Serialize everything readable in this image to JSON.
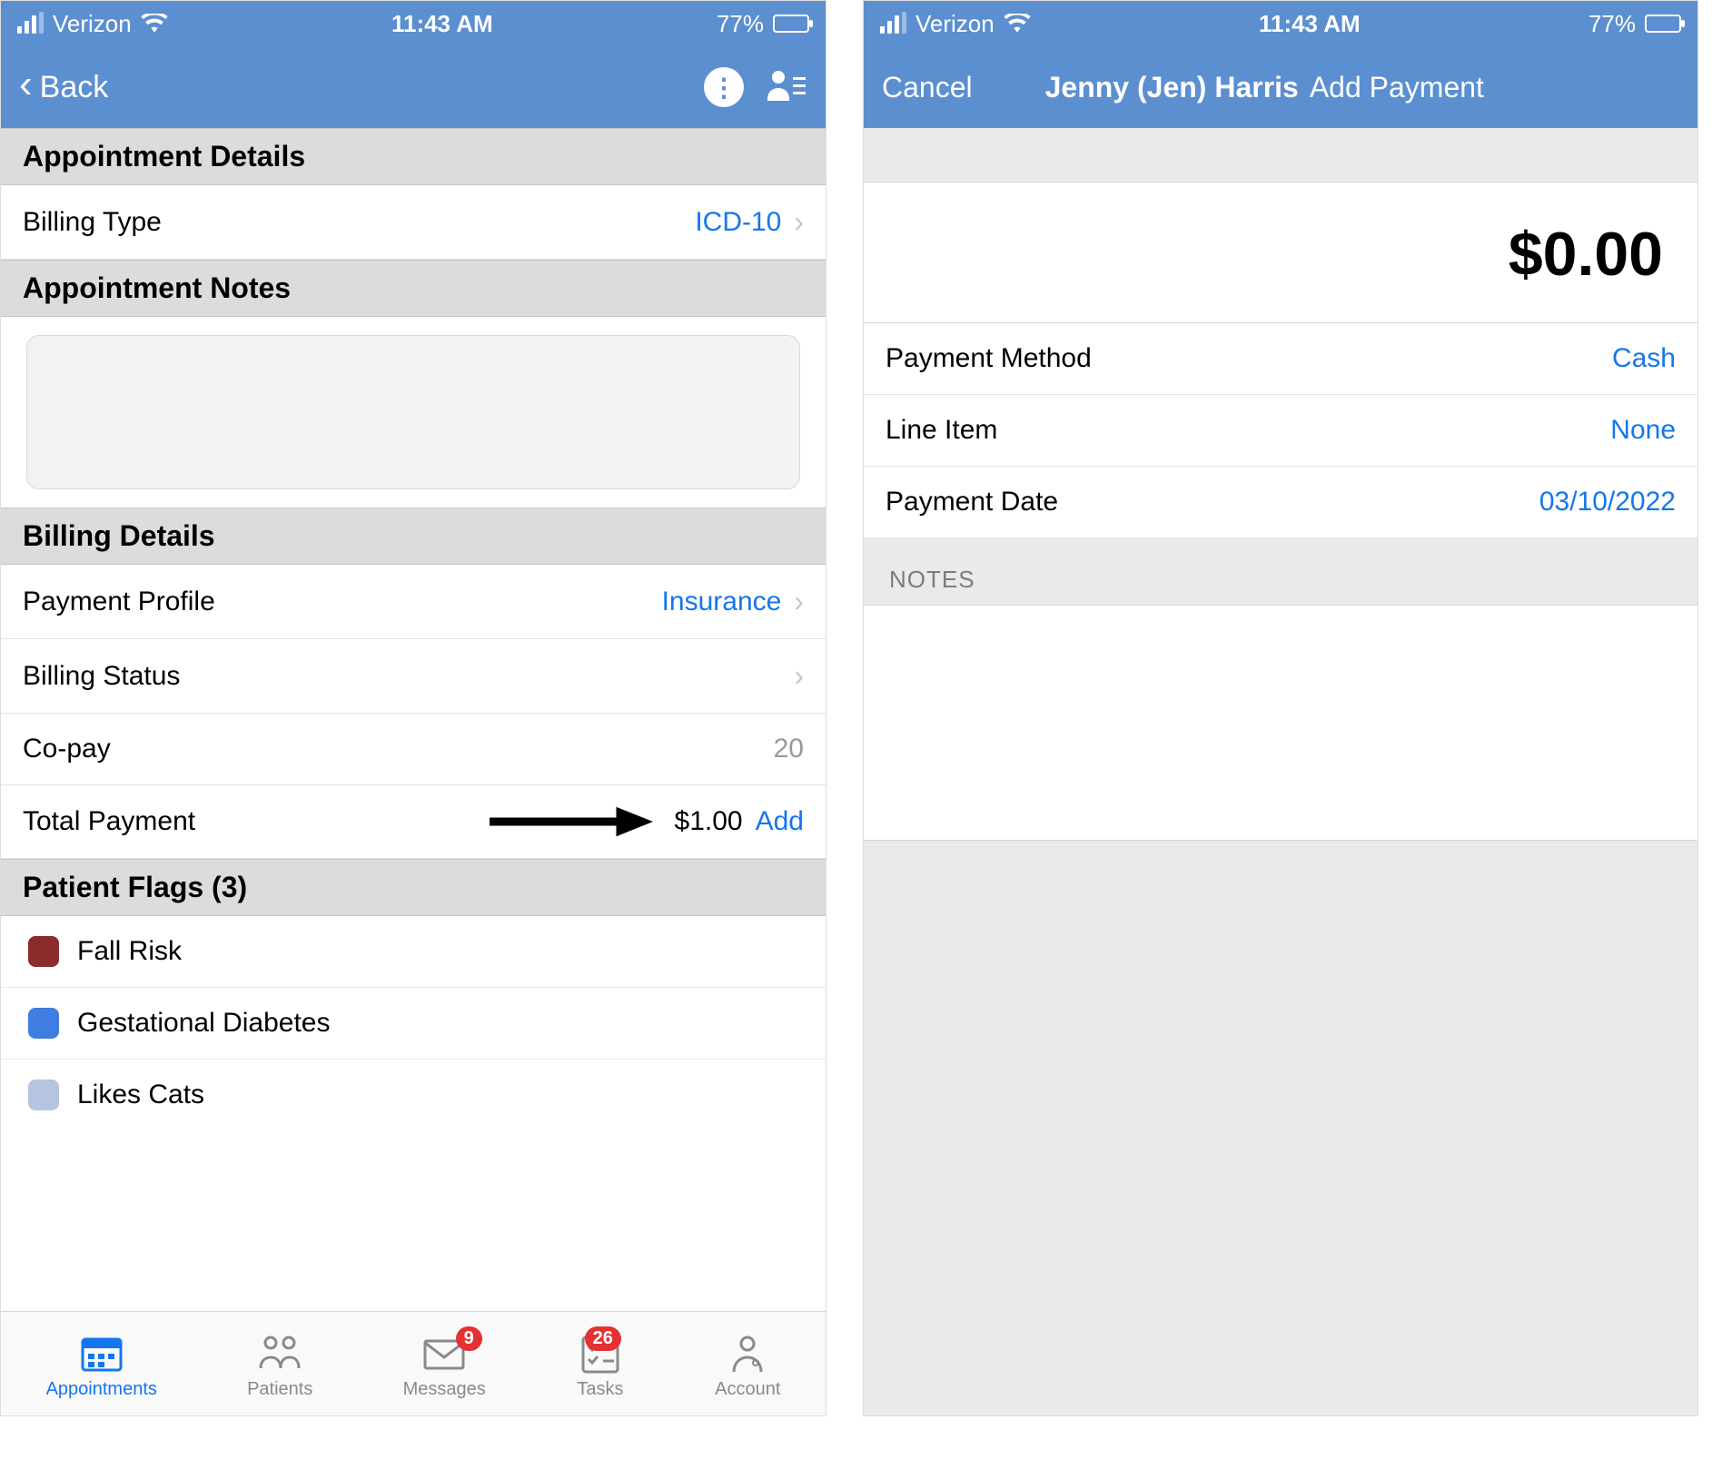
{
  "statusbar": {
    "carrier": "Verizon",
    "time": "11:43 AM",
    "battery_pct": "77%"
  },
  "left": {
    "nav": {
      "back_label": "Back"
    },
    "sections": {
      "appt_details_header": "Appointment Details",
      "billing_type": {
        "label": "Billing Type",
        "value": "ICD-10"
      },
      "appt_notes_header": "Appointment Notes",
      "billing_details_header": "Billing Details",
      "payment_profile": {
        "label": "Payment Profile",
        "value": "Insurance"
      },
      "billing_status": {
        "label": "Billing Status",
        "value": ""
      },
      "copay": {
        "label": "Co-pay",
        "value": "20"
      },
      "total_payment": {
        "label": "Total Payment",
        "value": "$1.00",
        "action": "Add"
      },
      "patient_flags_header": "Patient Flags (3)",
      "flags": [
        {
          "label": "Fall Risk",
          "color": "#8a2c2c"
        },
        {
          "label": "Gestational Diabetes",
          "color": "#3f7de0"
        },
        {
          "label": "Likes Cats",
          "color": "#b6c4df"
        }
      ]
    },
    "tabs": {
      "appointments": "Appointments",
      "patients": "Patients",
      "messages": "Messages",
      "messages_badge": "9",
      "tasks": "Tasks",
      "tasks_badge": "26",
      "account": "Account"
    }
  },
  "right": {
    "nav": {
      "cancel": "Cancel",
      "patient": "Jenny (Jen) Harris",
      "action": "Add Payment"
    },
    "amount": "$0.00",
    "rows": {
      "payment_method": {
        "label": "Payment Method",
        "value": "Cash"
      },
      "line_item": {
        "label": "Line Item",
        "value": "None"
      },
      "payment_date": {
        "label": "Payment Date",
        "value": "03/10/2022"
      }
    },
    "notes_header": "NOTES"
  }
}
